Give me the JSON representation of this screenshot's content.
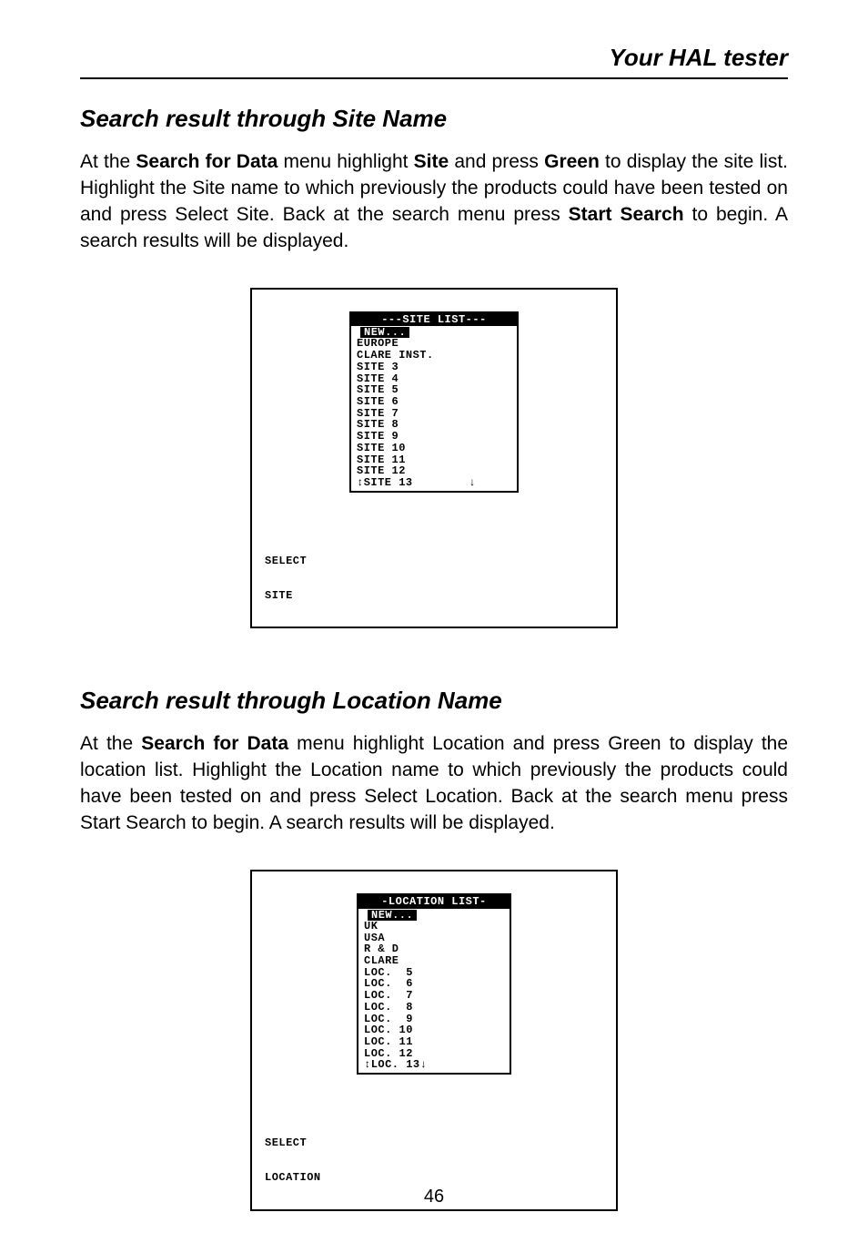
{
  "header": {
    "title": "Your HAL tester"
  },
  "section1": {
    "heading": "Search result through Site Name",
    "para_before_bold1": "At the ",
    "bold1": "Search for Data",
    "para_mid1": " menu highlight ",
    "bold2": "Site",
    "para_mid2": " and press ",
    "bold3": "Green",
    "para_mid3": " to display the site list. Highlight the Site name to which previously the products could have been tested on and press Select Site. Back at the search menu press ",
    "bold4": "Start Search",
    "para_after": " to begin. A search results will be displayed."
  },
  "lcd1": {
    "title": "---SITE LIST---",
    "selected": "NEW...",
    "items": [
      "EUROPE",
      "CLARE INST.",
      "SITE 3",
      "SITE 4",
      "SITE 5",
      "SITE 6",
      "SITE 7",
      "SITE 8",
      "SITE 9",
      "SITE 10",
      "SITE 11",
      "SITE 12",
      "↕SITE 13        ↓"
    ],
    "softkey_line1": "SELECT",
    "softkey_line2": "SITE"
  },
  "section2": {
    "heading": "Search result through Location Name",
    "para_before_bold1": "At the ",
    "bold1": "Search for Data",
    "para_after": " menu highlight Location and press Green to display the location list. Highlight the Location name to which previously the products could have been tested on and press Select Location. Back at the search menu press Start Search to begin. A search results will be displayed."
  },
  "lcd2": {
    "title": "-LOCATION LIST-",
    "selected": "NEW...",
    "items": [
      "UK",
      "USA",
      "R & D",
      "CLARE",
      "LOC.  5",
      "LOC.  6",
      "LOC.  7",
      "LOC.  8",
      "LOC.  9",
      "LOC. 10",
      "LOC. 11",
      "LOC. 12",
      "↕LOC. 13↓"
    ],
    "softkey_line1": "SELECT",
    "softkey_line2": "LOCATION"
  },
  "pageNumber": "46"
}
